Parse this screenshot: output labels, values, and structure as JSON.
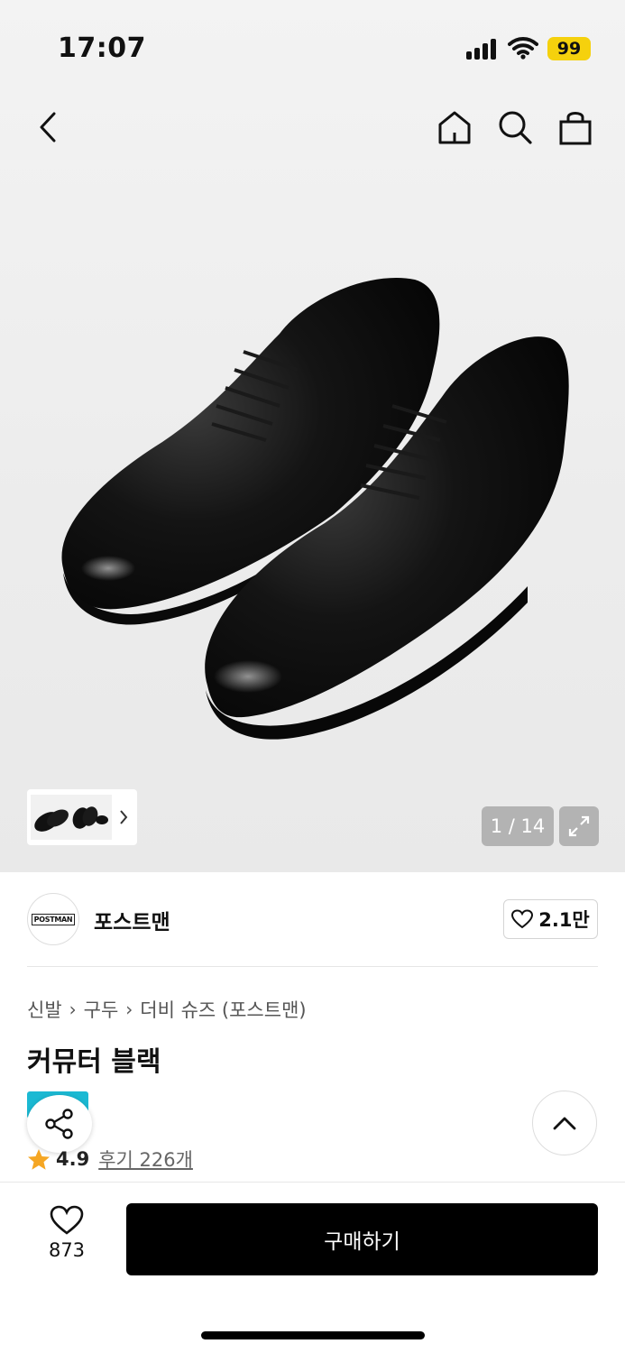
{
  "status_bar": {
    "time": "17:07",
    "battery": "99"
  },
  "gallery": {
    "counter": "1 / 14"
  },
  "brand": {
    "logo_text": "POSTMAN",
    "name": "포스트맨",
    "likes": "2.1만"
  },
  "breadcrumb": {
    "items": [
      "신발",
      "구두",
      "더비 슈즈 (포스트맨)"
    ]
  },
  "product": {
    "title": "커뮤터 블랙"
  },
  "rating": {
    "score": "4.9",
    "reviews": "후기 226개"
  },
  "bottom": {
    "wish_count": "873",
    "buy_label": "구매하기"
  },
  "colors": {
    "accent_badge": "#f5d10d",
    "star": "#f5a623",
    "teal": "#1bb9d3",
    "buy_bg": "#000000"
  }
}
